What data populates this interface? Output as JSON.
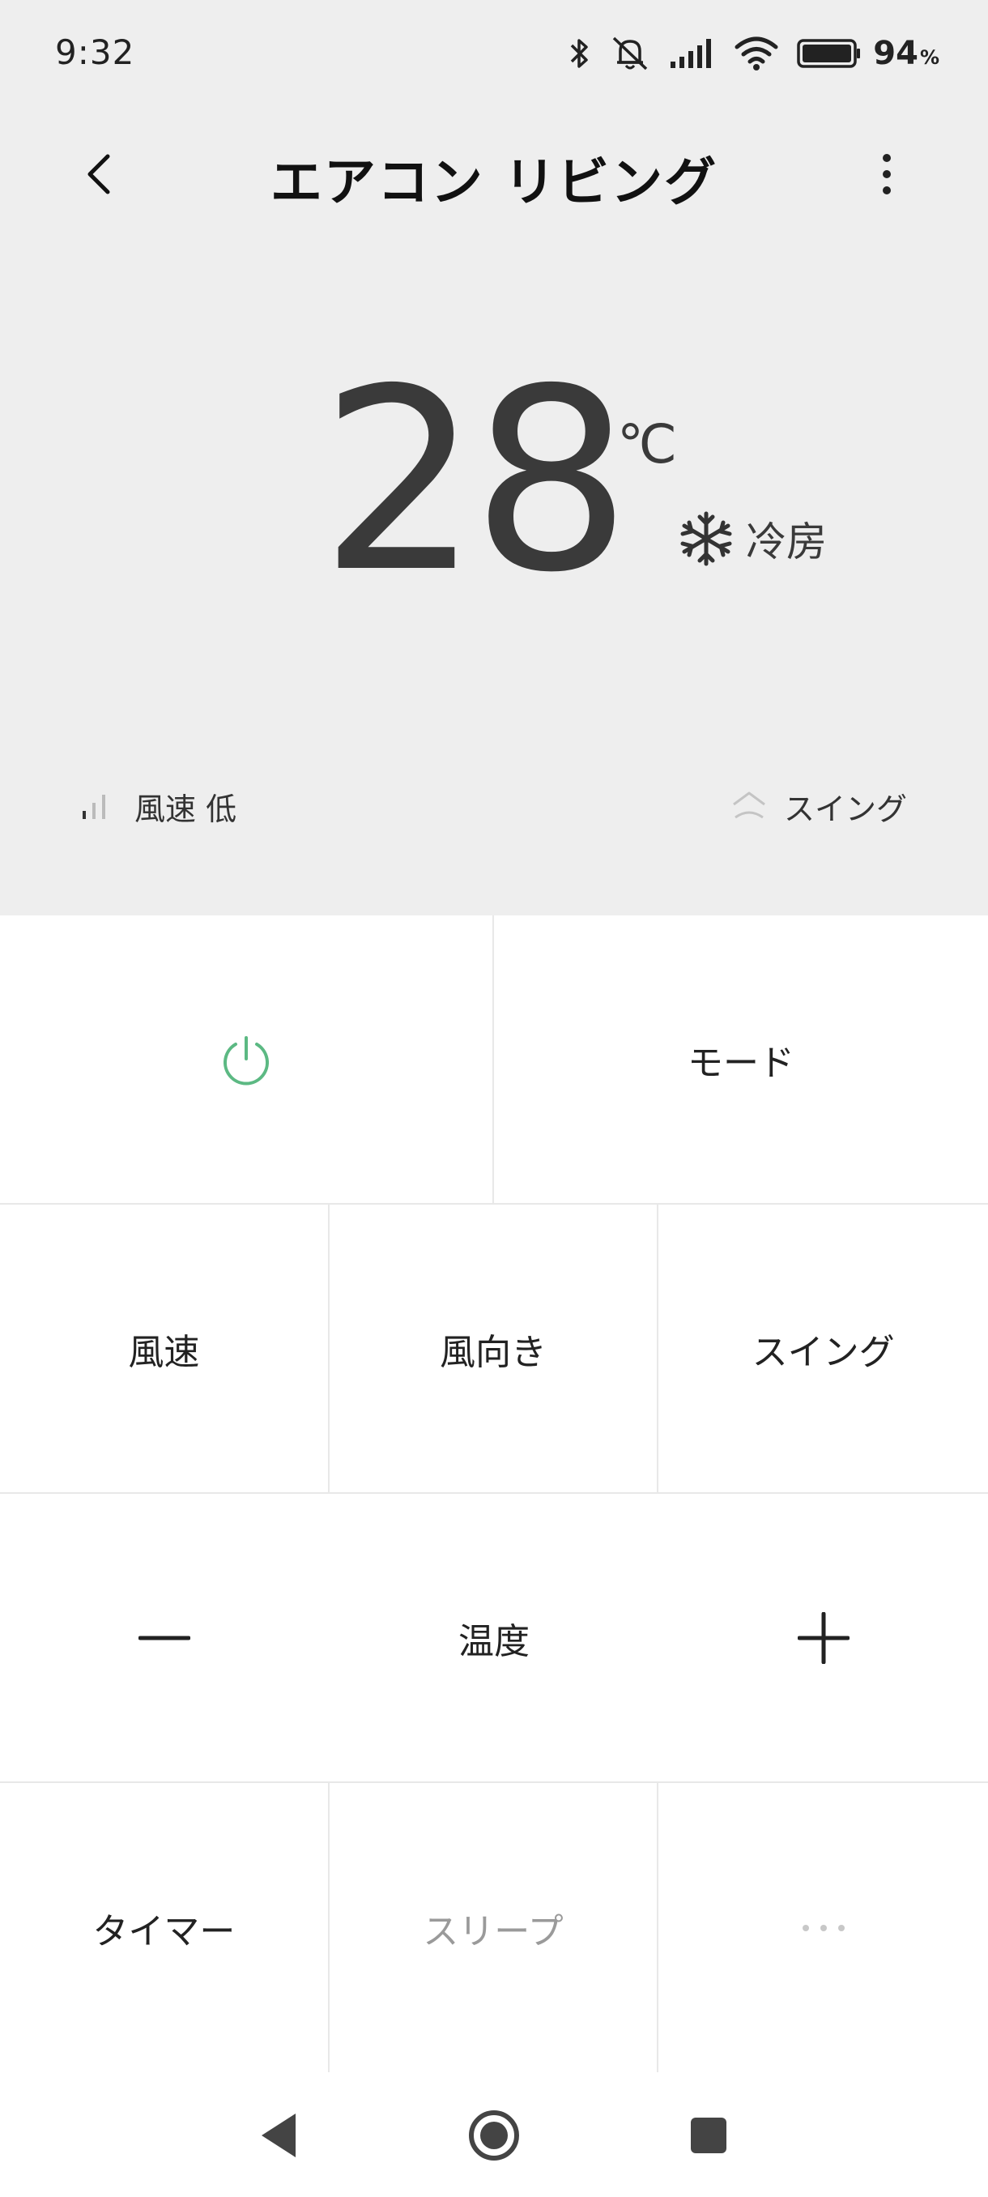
{
  "status_bar": {
    "time": "9:32",
    "battery_level": "94",
    "battery_unit": "%",
    "icons": [
      "bluetooth-icon",
      "mute-icon",
      "signal-icon",
      "wifi-icon",
      "battery-icon"
    ]
  },
  "header": {
    "title": "エアコン リビング",
    "back_icon": "chevron-left-icon",
    "more_icon": "more-vertical-icon"
  },
  "display": {
    "temperature": "28",
    "unit": "℃",
    "mode": "冷房",
    "mode_icon": "snowflake-icon",
    "fan_speed": "風速 低",
    "fan_icon": "signal-bars-icon",
    "swing": "スイング",
    "swing_icon": "swing-icon"
  },
  "controls": {
    "power_icon": "power-icon",
    "power_color": "#5cb983",
    "mode": "モード",
    "fan_speed": "風速",
    "wind_direction": "風向き",
    "swing": "スイング",
    "temp_minus": "−",
    "temp_label": "温度",
    "temp_plus": "+",
    "timer": "タイマー",
    "sleep": "スリープ",
    "more": "···"
  },
  "nav": {
    "back_icon": "nav-back-icon",
    "home_icon": "nav-home-icon",
    "recents_icon": "nav-recents-icon"
  }
}
